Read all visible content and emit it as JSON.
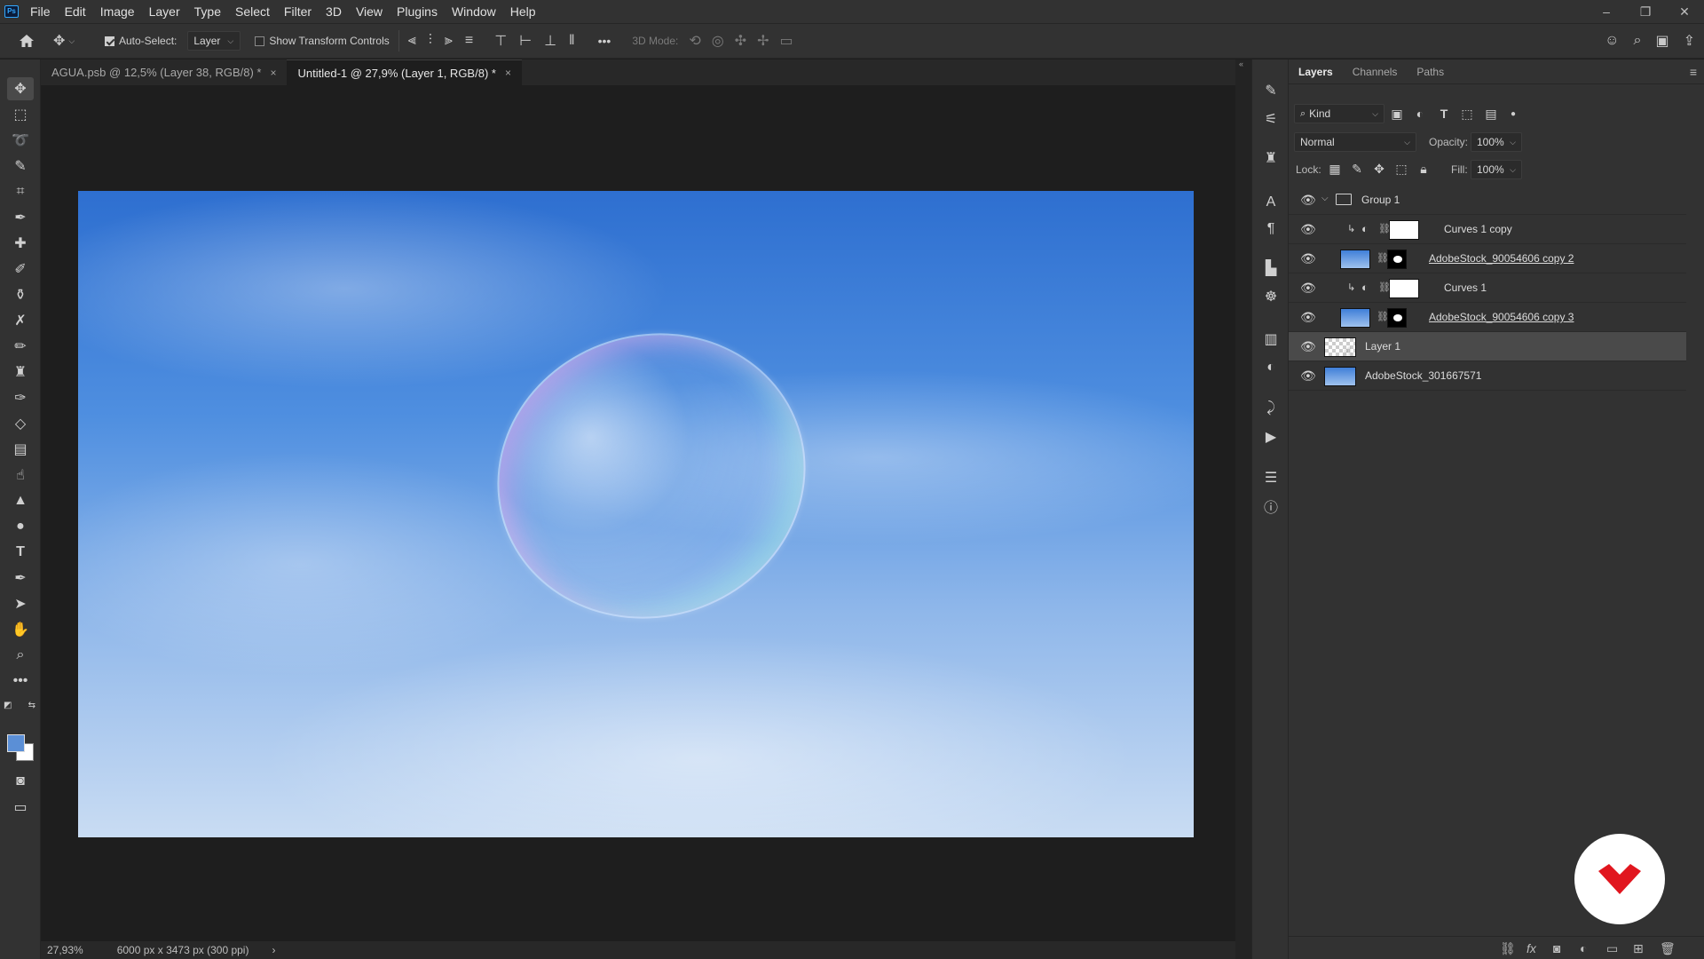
{
  "app": {
    "logo": "Ps"
  },
  "menu": [
    "File",
    "Edit",
    "Image",
    "Layer",
    "Type",
    "Select",
    "Filter",
    "3D",
    "View",
    "Plugins",
    "Window",
    "Help"
  ],
  "window_controls": {
    "minimize": "–",
    "restore": "❐",
    "close": "✕"
  },
  "options": {
    "auto_select_label": "Auto-Select:",
    "auto_select_checked": true,
    "auto_select_target": "Layer",
    "show_transform_label": "Show Transform Controls",
    "more": "•••",
    "mode_3d_label": "3D Mode:"
  },
  "tabs": [
    {
      "label": "AGUA.psb @ 12,5% (Layer 38, RGB/8) *",
      "close": "×",
      "active": false
    },
    {
      "label": "Untitled-1 @ 27,9% (Layer 1, RGB/8) *",
      "close": "×",
      "active": true
    }
  ],
  "status": {
    "zoom": "27,93%",
    "doc_info": "6000 px x 3473 px (300 ppi)",
    "arrow": "›"
  },
  "layers_panel": {
    "tabs": [
      "Layers",
      "Channels",
      "Paths"
    ],
    "active_tab": "Layers",
    "filter_kind": "Kind",
    "blend_mode": "Normal",
    "opacity_label": "Opacity:",
    "opacity_value": "100%",
    "lock_label": "Lock:",
    "fill_label": "Fill:",
    "fill_value": "100%",
    "layers": [
      {
        "name": "Group 1",
        "type": "group",
        "visible": true
      },
      {
        "name": "Curves 1 copy",
        "type": "adjustment",
        "visible": true,
        "clipped": true
      },
      {
        "name": "AdobeStock_90054606 copy 2",
        "type": "smart",
        "visible": true
      },
      {
        "name": "Curves 1",
        "type": "adjustment",
        "visible": true,
        "clipped": true
      },
      {
        "name": "AdobeStock_90054606 copy 3",
        "type": "smart",
        "visible": true
      },
      {
        "name": "Layer 1",
        "type": "pixel",
        "visible": true,
        "selected": true
      },
      {
        "name": "AdobeStock_301667571",
        "type": "smart-base",
        "visible": true
      }
    ]
  },
  "colors": {
    "foreground": "#5b8fd6",
    "background": "#ffffff",
    "watermark": "#e1161f"
  }
}
